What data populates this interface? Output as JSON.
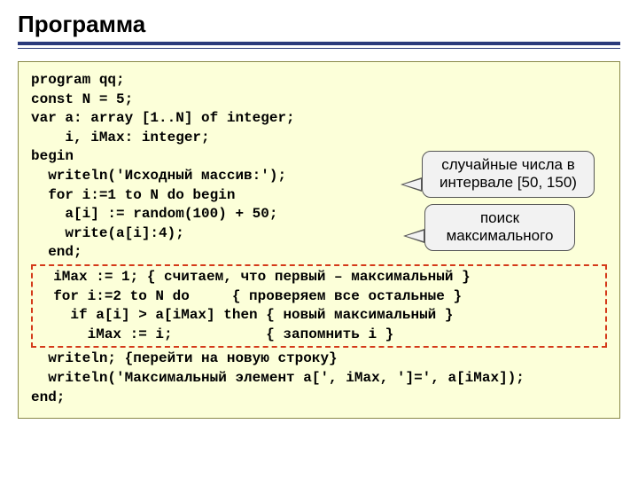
{
  "title": "Программа",
  "code": {
    "l1": "program qq;",
    "l2": "const N = 5;",
    "l3": "var a: array [1..N] of integer;",
    "l4": "    i, iMax: integer;",
    "l5": "begin",
    "l6": "  writeln('Исходный массив:');",
    "l7": "  for i:=1 to N do begin",
    "l8": "    a[i] := random(100) + 50;",
    "l9": "    write(a[i]:4);",
    "l10": "  end;",
    "l11": "  iMax := 1; { считаем, что первый – максимальный }",
    "l12": "  for i:=2 to N do     { проверяем все остальные }",
    "l13": "    if a[i] > a[iMax] then { новый максимальный }",
    "l14": "      iMax := i;           { запомнить i }",
    "l15": "  writeln; {перейти на новую строку}",
    "l16": "  writeln('Максимальный элемент a[', iMax, ']=', a[iMax]);",
    "l17": "end;"
  },
  "callouts": {
    "c1_line1": "случайные числа в",
    "c1_line2": "интервале [50, 150)",
    "c2_line1": "поиск",
    "c2_line2": "максимального"
  }
}
